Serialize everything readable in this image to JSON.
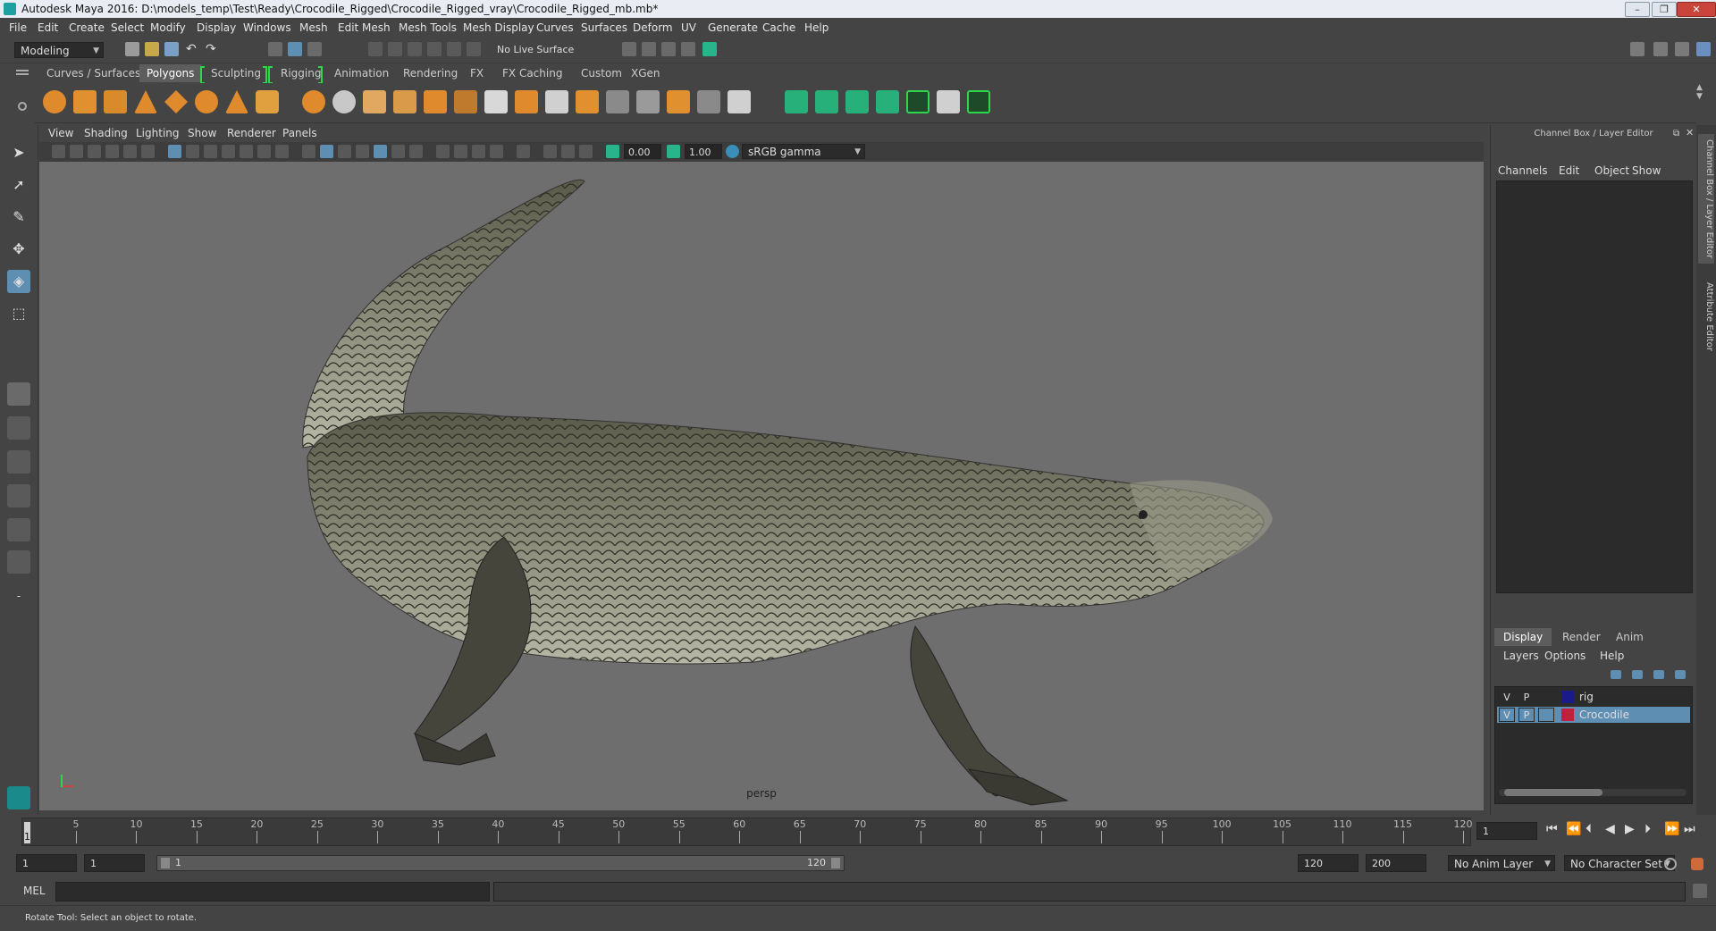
{
  "window": {
    "title": "Autodesk Maya 2016: D:\\models_temp\\Test\\Ready\\Crocodile_Rigged\\Crocodile_Rigged_vray\\Crocodile_Rigged_mb.mb*",
    "minimize": "–",
    "maximize": "❐",
    "close": "✕"
  },
  "menubar": [
    "File",
    "Edit",
    "Create",
    "Select",
    "Modify",
    "Display",
    "Windows",
    "Mesh",
    "Edit Mesh",
    "Mesh Tools",
    "Mesh Display",
    "Curves",
    "Surfaces",
    "Deform",
    "UV",
    "Generate",
    "Cache",
    "Help"
  ],
  "statusline": {
    "menu_set": "Modeling",
    "live_surface": "No Live Surface"
  },
  "shelf_tabs": [
    "Curves / Surfaces",
    "Polygons",
    "Sculpting",
    "Rigging",
    "Animation",
    "Rendering",
    "FX",
    "FX Caching",
    "Custom",
    "XGen"
  ],
  "active_shelf_tab": "Polygons",
  "panel_menu": [
    "View",
    "Shading",
    "Lighting",
    "Show",
    "Renderer",
    "Panels"
  ],
  "panel_toolbar": {
    "exposure": "0.00",
    "gamma": "1.00",
    "color_space": "sRGB gamma"
  },
  "viewport": {
    "camera_label": "persp"
  },
  "right_panel": {
    "title": "Channel Box / Layer Editor",
    "menu": [
      "Channels",
      "Edit",
      "Object",
      "Show"
    ],
    "tabs": [
      "Display",
      "Render",
      "Anim"
    ],
    "active_tab": "Display",
    "layer_menu": [
      "Layers",
      "Options",
      "Help"
    ],
    "layers": [
      {
        "v": "V",
        "p": "P",
        "name": "rig",
        "color": "#1a1a8a",
        "selected": false
      },
      {
        "v": "V",
        "p": "P",
        "name": "Crocodile",
        "color": "#c0203a",
        "selected": true
      }
    ]
  },
  "side_tabs": [
    "Channel Box / Layer Editor",
    "Attribute Editor"
  ],
  "time_slider": {
    "ticks": [
      "5",
      "10",
      "15",
      "20",
      "25",
      "30",
      "35",
      "40",
      "45",
      "50",
      "55",
      "60",
      "65",
      "70",
      "75",
      "80",
      "85",
      "90",
      "95",
      "100",
      "105",
      "110",
      "115",
      "120"
    ],
    "start_marker": "1",
    "current_frame": "1"
  },
  "range_slider": {
    "start_time": "1",
    "playback_start": "1",
    "range_start_label": "1",
    "range_end_label": "120",
    "playback_end": "120",
    "end_time": "200",
    "anim_layer": "No Anim Layer",
    "character_set": "No Character Set"
  },
  "command_line": {
    "language": "MEL"
  },
  "help_line": "Rotate Tool: Select an object to rotate.",
  "colors": {
    "accent_blue": "#5f8eb3",
    "shelf_bracket_green": "#2fd54a",
    "viewport_bg": "#6e6e6e"
  }
}
